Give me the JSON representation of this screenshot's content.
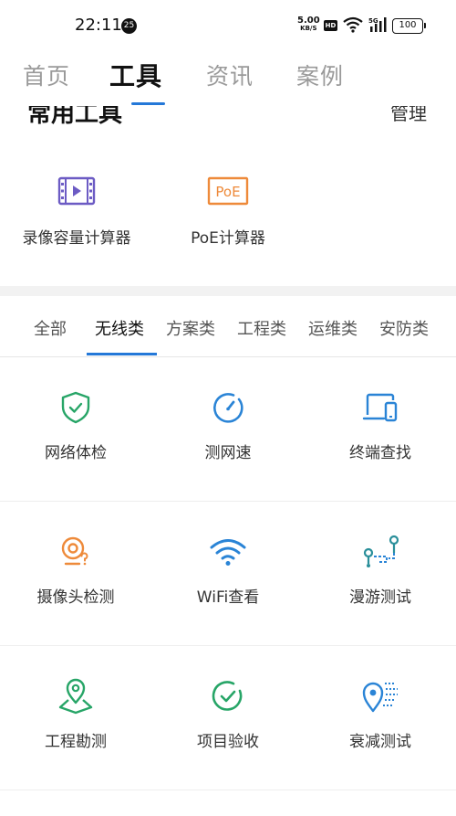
{
  "status_bar": {
    "time": "22:11",
    "notification_count": "25",
    "net_speed_value": "5.00",
    "net_speed_unit": "KB/S",
    "hd_label": "HD",
    "signal_label": "5G",
    "battery": "100"
  },
  "top_tabs": [
    {
      "label": "首页",
      "active": false
    },
    {
      "label": "工具",
      "active": true
    },
    {
      "label": "资讯",
      "active": false
    },
    {
      "label": "案例",
      "active": false
    }
  ],
  "common_tools": {
    "title": "常用工具",
    "manage_label": "管理",
    "items": [
      {
        "label": "录像容量计算器",
        "icon": "video-storage-icon"
      },
      {
        "label": "PoE计算器",
        "icon": "poe-icon",
        "icon_text": "PoE"
      }
    ]
  },
  "category_tabs": [
    {
      "label": "全部",
      "active": false
    },
    {
      "label": "无线类",
      "active": true
    },
    {
      "label": "方案类",
      "active": false
    },
    {
      "label": "工程类",
      "active": false
    },
    {
      "label": "运维类",
      "active": false
    },
    {
      "label": "安防类",
      "active": false
    }
  ],
  "tools": [
    {
      "label": "网络体检",
      "icon": "shield-check-icon"
    },
    {
      "label": "测网速",
      "icon": "speedometer-icon"
    },
    {
      "label": "终端查找",
      "icon": "devices-icon"
    },
    {
      "label": "摄像头检测",
      "icon": "camera-question-icon"
    },
    {
      "label": "WiFi查看",
      "icon": "wifi-icon"
    },
    {
      "label": "漫游测试",
      "icon": "roaming-icon"
    },
    {
      "label": "工程勘测",
      "icon": "location-survey-icon"
    },
    {
      "label": "项目验收",
      "icon": "check-circle-icon"
    },
    {
      "label": "衰减测试",
      "icon": "signal-attenuation-icon"
    }
  ],
  "colors": {
    "accent": "#2478d8",
    "purple": "#6c5bc4",
    "orange": "#ee8a3a",
    "green": "#27a567",
    "blue": "#2a84d6",
    "teal": "#2a8f9a"
  }
}
